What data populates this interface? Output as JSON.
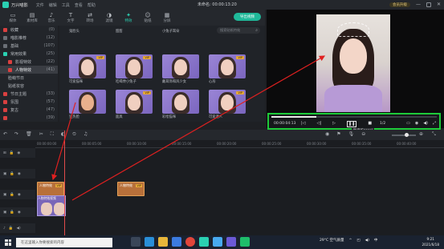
{
  "titlebar": {
    "app_title": "万兴喵影",
    "menu": [
      "文件",
      "编辑",
      "工具",
      "查看",
      "帮助"
    ],
    "project": "未命名: 00:00:13:20",
    "member_label": "会员升级"
  },
  "tabs": [
    {
      "label": "媒体",
      "icon": "folder-icon",
      "glyph": "▭"
    },
    {
      "label": "素材库",
      "icon": "library-icon",
      "glyph": "▤"
    },
    {
      "label": "音乐",
      "icon": "music-icon",
      "glyph": "♪"
    },
    {
      "label": "文字",
      "icon": "text-icon",
      "glyph": "T"
    },
    {
      "label": "转场",
      "icon": "transition-icon",
      "glyph": "⇄"
    },
    {
      "label": "滤镜",
      "icon": "filter-icon",
      "glyph": "◑"
    },
    {
      "label": "特效",
      "icon": "effects-icon",
      "glyph": "✦"
    },
    {
      "label": "贴纸",
      "icon": "sticker-icon",
      "glyph": "☺"
    },
    {
      "label": "分屏",
      "icon": "split-icon",
      "glyph": "▦"
    }
  ],
  "export_label": "导出视频",
  "categories": [
    {
      "label": "收藏",
      "count": "(0)"
    },
    {
      "label": "喵影推荐",
      "count": "(12)"
    },
    {
      "label": "基础",
      "count": "(107)"
    },
    {
      "label": "常用效果",
      "count": "(25)"
    },
    {
      "label": "影视特效",
      "count": "(22)"
    },
    {
      "label": "人物特效",
      "count": "(41)"
    },
    {
      "label": "脸萌节日",
      "count": ""
    },
    {
      "label": "贴纸妆容",
      "count": ""
    },
    {
      "label": "节日主题",
      "count": "(33)"
    },
    {
      "label": "氛围",
      "count": "(57)"
    },
    {
      "label": "复古",
      "count": "(47)"
    },
    {
      "label": "",
      "count": "(39)"
    }
  ],
  "search_placeholder": "搜索贴纸特效",
  "effects_grid": [
    {
      "label": "鬼脸头"
    },
    {
      "label": "甜甜"
    },
    {
      "label": "小兔子耳朵"
    },
    {
      "label": "",
      "vip": "VIP"
    },
    {
      "label": "可爱猫咪"
    },
    {
      "label": "吃喝馋小兔子"
    },
    {
      "label": "戴耳饰和风少女"
    },
    {
      "label": "心形"
    },
    {
      "label": "狂热脸"
    },
    {
      "label": "面具"
    },
    {
      "label": "彩绘猫咪"
    },
    {
      "label": "可爱老人"
    }
  ],
  "vip_badge": "VIP",
  "player": {
    "progress": 0.27,
    "timecode": "00:00:04:13",
    "ratio": "1/2",
    "tooltip": "暂停(Space)"
  },
  "timeline": {
    "ruler": [
      "00:00:00:00",
      "00:00:05:00",
      "00:00:10:00",
      "00:00:15:00",
      "00:00:20:00",
      "00:00:25:00",
      "00:00:30:00",
      "00:00:35:00",
      "00:00:40:00"
    ],
    "clip_fx_1": "人物特效",
    "clip_fx_2": "人物特效",
    "clip_video": "人物特效视频"
  },
  "taskbar": {
    "search_placeholder": "在这里输入你要搜索的内容",
    "weather": "29°C 空气质量",
    "lang": "中",
    "time": "9:21",
    "date": "2021/6/18"
  }
}
